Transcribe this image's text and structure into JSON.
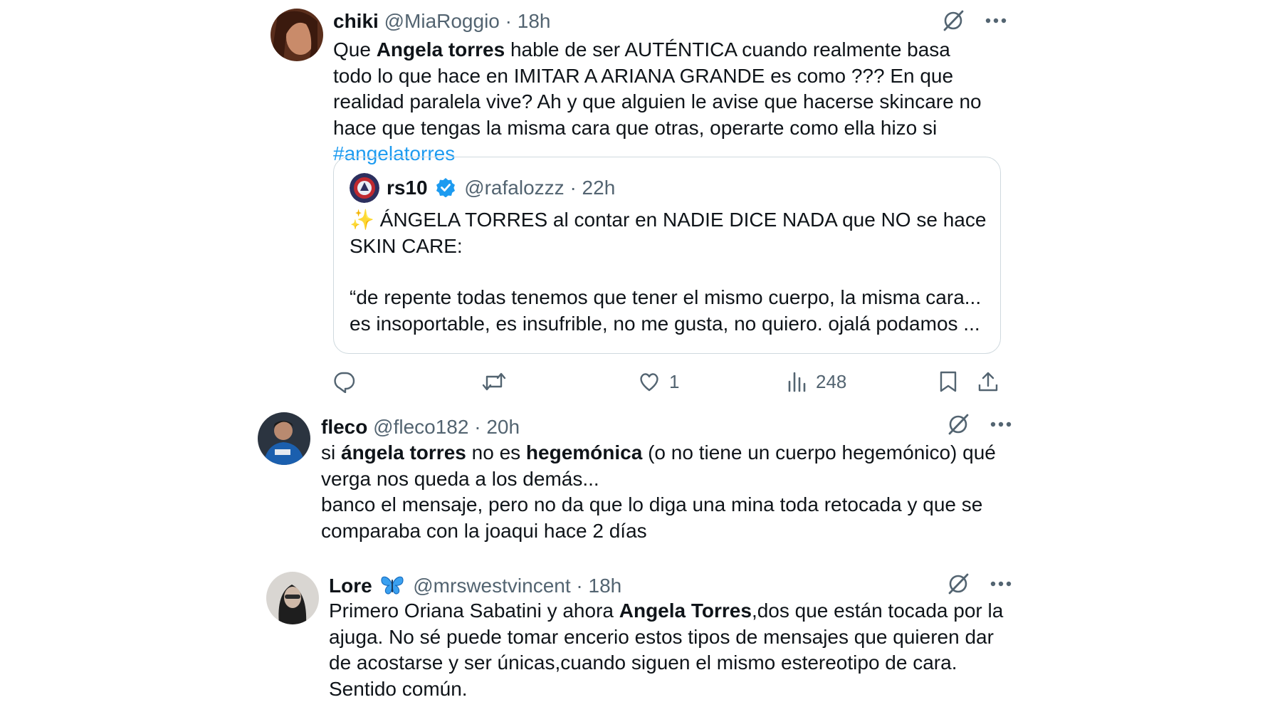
{
  "tweets": [
    {
      "name": "chiki",
      "handle": "@MiaRoggio",
      "time": "18h",
      "text": {
        "t1": "Que ",
        "b1": "Angela torres",
        "t2": " hable de ser AUTÉNTICA cuando realmente basa todo lo que hace en IMITAR A ARIANA GRANDE es como ??? En que realidad paralela vive? Ah y que alguien le avise que hacerse skincare no hace que tengas la misma cara que otras, operarte como ella hizo si ",
        "hashtag": "#angelatorres"
      },
      "quote": {
        "name": "rs10",
        "handle": "@rafalozzz",
        "time": "22h",
        "line1": "✨ ÁNGELA TORRES al contar en NADIE DICE NADA que NO se hace SKIN CARE:",
        "line2": "“de repente todas tenemos que tener el mismo cuerpo, la misma cara... es insoportable, es insufrible, no me gusta, no quiero. ojalá podamos ..."
      },
      "actions": {
        "likes": "1",
        "views": "248"
      }
    },
    {
      "name": "fleco",
      "handle": "@fleco182",
      "time": "20h",
      "text": {
        "t1": "si ",
        "b1": "ángela torres",
        "t2": " no es ",
        "b2": "hegemónica",
        "t3": " (o no tiene un cuerpo hegemónico) qué verga nos queda a los demás...",
        "p2": "banco el mensaje, pero no da que lo diga una mina toda retocada y que se comparaba con la joaqui hace 2 días"
      }
    },
    {
      "name": "Lore",
      "name_emoji": "butterfly-icon",
      "handle": "@mrswestvincent",
      "time": "18h",
      "text": {
        "t1": "Primero Oriana Sabatini y ahora ",
        "b1": "Angela Torres",
        "t2": ",dos que están tocada por la ajuga. No sé puede tomar encerio estos tipos de mensajes que quieren dar de acostarse y ser únicas,cuando siguen el mismo estereotipo de cara. Sentido común."
      }
    }
  ],
  "separator": "·",
  "colors": {
    "text": "#0f1419",
    "secondary": "#536471",
    "link": "#1d9bf0",
    "border": "#cfd9de",
    "verified": "#1d9bf0"
  }
}
